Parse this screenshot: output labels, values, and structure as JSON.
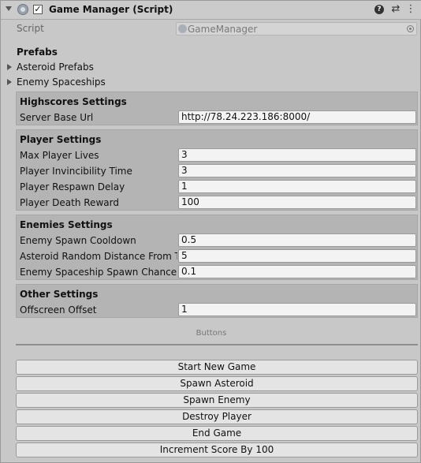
{
  "header": {
    "title": "Game Manager (Script)",
    "checked": "✓"
  },
  "script_row": {
    "label": "Script",
    "value": "GameManager"
  },
  "prefabs": {
    "title": "Prefabs",
    "items": [
      "Asteroid Prefabs",
      "Enemy Spaceships"
    ]
  },
  "sections": [
    {
      "title": "Highscores Settings",
      "rows": [
        {
          "label": "Server Base Url",
          "value": "http://78.24.223.186:8000/"
        }
      ]
    },
    {
      "title": "Player Settings",
      "rows": [
        {
          "label": "Max Player Lives",
          "value": "3"
        },
        {
          "label": "Player Invincibility Time",
          "value": "3"
        },
        {
          "label": "Player Respawn Delay",
          "value": "1"
        },
        {
          "label": "Player Death Reward",
          "value": "100"
        }
      ]
    },
    {
      "title": "Enemies Settings",
      "rows": [
        {
          "label": "Enemy Spawn Cooldown",
          "value": "0.5"
        },
        {
          "label": "Asteroid Random Distance From Target",
          "value": "5"
        },
        {
          "label": "Enemy Spaceship Spawn Chance",
          "value": "0.1"
        }
      ]
    },
    {
      "title": "Other Settings",
      "rows": [
        {
          "label": "Offscreen Offset",
          "value": "1"
        }
      ]
    }
  ],
  "buttons_section": {
    "label": "Buttons",
    "buttons": [
      "Start New Game",
      "Spawn Asteroid",
      "Spawn Enemy",
      "Destroy Player",
      "End Game",
      "Increment Score By 100"
    ]
  },
  "icons": {
    "help": "help-icon",
    "presets": "presets-icon",
    "menu": "kebab-menu-icon"
  }
}
